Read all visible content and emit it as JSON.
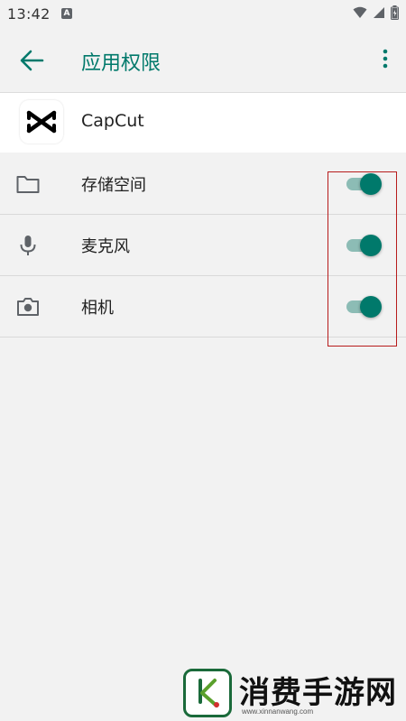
{
  "status_bar": {
    "time": "13:42",
    "notification_icon_letter": "A",
    "icons": [
      "wifi-icon",
      "signal-icon",
      "battery-icon"
    ]
  },
  "app_bar": {
    "title": "应用权限",
    "back_icon": "arrow-left-icon",
    "more_icon": "more-vertical-icon",
    "title_color": "#00796b"
  },
  "app": {
    "name": "CapCut",
    "logo_icon": "capcut-logo"
  },
  "permissions": [
    {
      "label": "存储空间",
      "icon": "folder-icon",
      "enabled": true
    },
    {
      "label": "麦克风",
      "icon": "microphone-icon",
      "enabled": true
    },
    {
      "label": "相机",
      "icon": "camera-icon",
      "enabled": true
    }
  ],
  "colors": {
    "accent": "#00796b",
    "switch_track_on": "#8cbcb5",
    "highlight_border": "#b71c1c",
    "background": "#f2f2f2"
  },
  "watermark": {
    "text": "消费手游网",
    "url": "www.xinnanwang.com"
  }
}
